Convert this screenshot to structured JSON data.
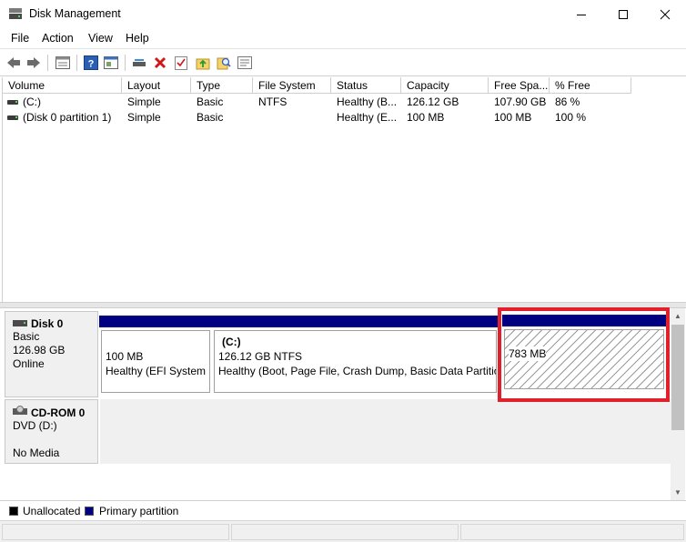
{
  "window": {
    "title": "Disk Management"
  },
  "menu": [
    "File",
    "Action",
    "View",
    "Help"
  ],
  "toolbar": {
    "icons": [
      "back-arrow-icon",
      "forward-arrow-icon",
      "disk-list-icon",
      "help-icon",
      "properties-icon",
      "connect-icon",
      "delete-icon",
      "check-icon",
      "folder-up-icon",
      "search-disk-icon",
      "details-icon"
    ]
  },
  "volumes": {
    "columns": [
      "Volume",
      "Layout",
      "Type",
      "File System",
      "Status",
      "Capacity",
      "Free Spa...",
      "% Free"
    ],
    "rows": [
      [
        "(C:)",
        "Simple",
        "Basic",
        "NTFS",
        "Healthy (B...",
        "126.12 GB",
        "107.90 GB",
        "86 %"
      ],
      [
        "(Disk 0 partition 1)",
        "Simple",
        "Basic",
        "",
        "Healthy (E...",
        "100 MB",
        "100 MB",
        "100 %"
      ]
    ]
  },
  "disks": [
    {
      "name": "Disk 0",
      "lines": [
        "Basic",
        "126.98 GB",
        "Online"
      ],
      "partitions": [
        {
          "size": "100 MB",
          "status": "Healthy (EFI System I"
        },
        {
          "label": "(C:)",
          "size": "126.12 GB NTFS",
          "status": "Healthy (Boot, Page File, Crash Dump, Basic Data Partition"
        },
        {
          "size": "783 MB",
          "status": ""
        }
      ]
    },
    {
      "name": "CD-ROM 0",
      "lines": [
        "DVD (D:)",
        "",
        "No Media"
      ]
    }
  ],
  "legend": [
    {
      "label": "Unallocated",
      "color": "#000000"
    },
    {
      "label": "Primary partition",
      "color": "#000080"
    }
  ],
  "colors": {
    "highlight": "#e0202a",
    "partition_bar": "#000080"
  }
}
